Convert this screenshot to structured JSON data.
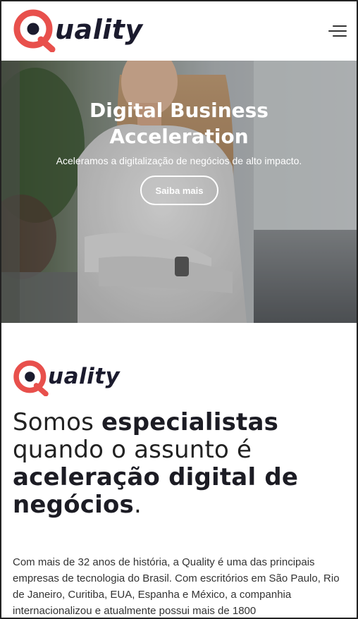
{
  "brand": {
    "name_rest": "uality",
    "colors": {
      "accent": "#e8504c",
      "dark": "#1b1b2e"
    }
  },
  "header": {
    "menu_icon": "hamburger-menu-icon"
  },
  "hero": {
    "title_line1": "Digital Business",
    "title_line2": "Acceleration",
    "subtitle": "Aceleramos a digitalização de negócios de alto impacto.",
    "cta_label": "Saiba mais"
  },
  "about": {
    "headline": {
      "part1": "Somos ",
      "part2_bold": "especialistas",
      "part3": "quando o assunto é",
      "part4_bold": "aceleração digital de negócios",
      "part5": "."
    },
    "paragraph": "Com mais de 32 anos de história, a Quality é uma das principais empresas de tecnologia do Brasil. Com escritórios em São Paulo, Rio de Janeiro, Curitiba, EUA, Espanha e México, a companhia internacionalizou e atualmente possui mais de 1800"
  }
}
